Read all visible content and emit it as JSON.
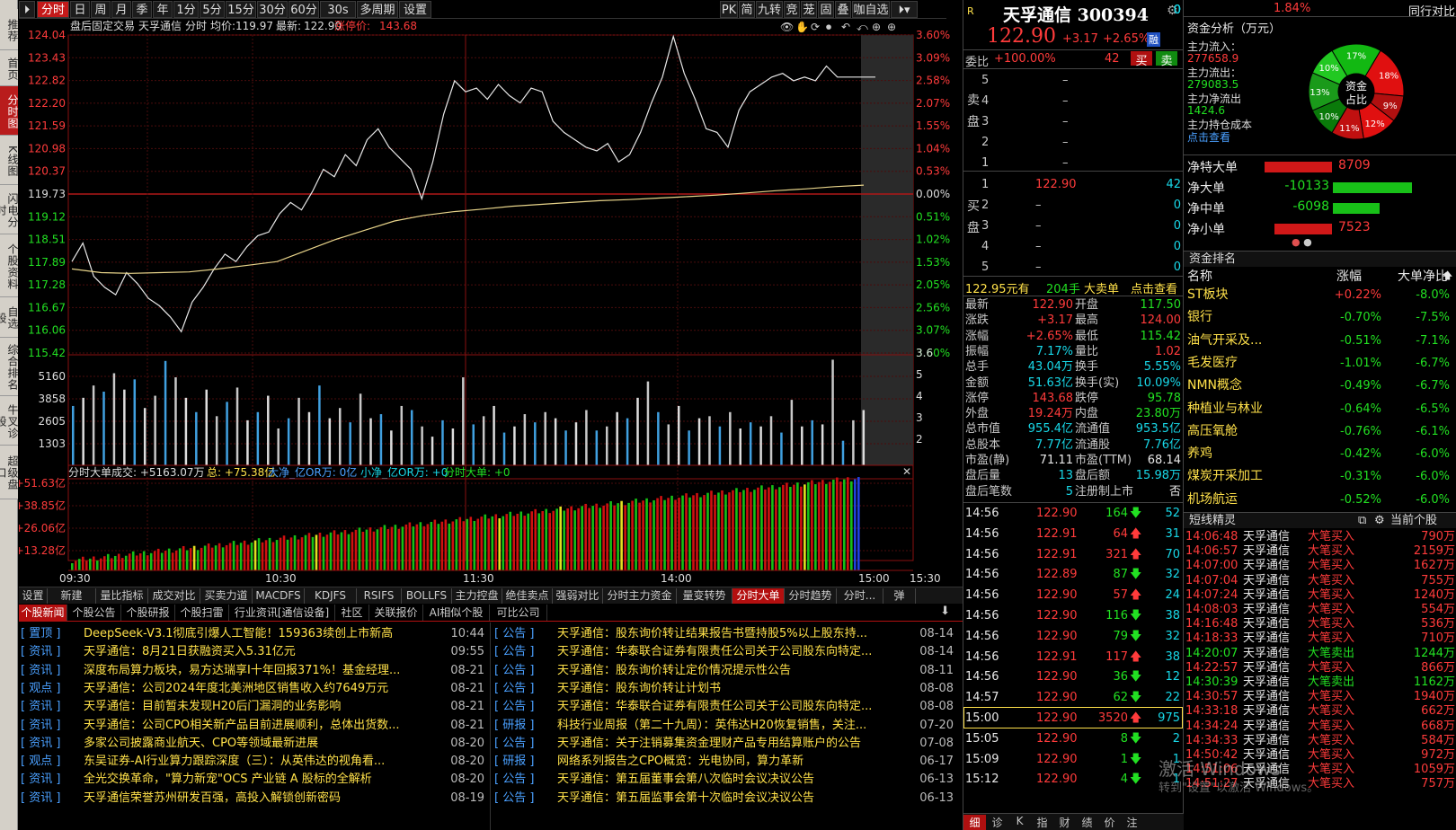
{
  "left_nav": [
    "推荐",
    "首页",
    "分时图",
    "K线图",
    "闪电分时",
    "个股资料",
    "自选股",
    "综合排名",
    "牛叉诊股",
    "超级盘口"
  ],
  "top_tabs": [
    "分时",
    "日",
    "周",
    "月",
    "季",
    "年",
    "1分",
    "5分",
    "15分",
    "30分",
    "60分",
    "30s",
    "多周期",
    "设置"
  ],
  "top_right_tabs": [
    "PK",
    "简",
    "九转",
    "竞",
    "茏",
    "固",
    "叠",
    "咖自选"
  ],
  "chart_header": {
    "title": "盘后固定交易",
    "stock": "天孚通信",
    "mode": "分时",
    "avg_label": "均价:",
    "avg": "119.97",
    "last_label": "最新:",
    "last": "122.90",
    "limit_label": "涨停价:",
    "limit": "143.68"
  },
  "chart_data": {
    "type": "line",
    "price_ticks": [
      "124.04",
      "123.43",
      "122.82",
      "122.20",
      "121.59",
      "120.98",
      "120.37",
      "119.73",
      "119.12",
      "118.51",
      "117.89",
      "117.28",
      "116.67",
      "116.06",
      "115.42"
    ],
    "pct_ticks": [
      "3.60%",
      "3.09%",
      "2.58%",
      "2.07%",
      "1.55%",
      "1.04%",
      "0.53%",
      "0.00%",
      "0.51%",
      "1.02%",
      "1.53%",
      "2.05%",
      "2.56%",
      "3.07%",
      "3.60%"
    ],
    "ylim": [
      115.42,
      124.04
    ],
    "prev_close": 119.73,
    "price": [
      117.9,
      118.4,
      117.5,
      117.2,
      117.0,
      117.6,
      117.3,
      116.9,
      116.7,
      116.4,
      116.0,
      116.8,
      117.2,
      117.7,
      118.1,
      117.9,
      118.3,
      118.6,
      118.7,
      119.2,
      119.5,
      119.3,
      119.8,
      120.4,
      120.2,
      120.8,
      120.5,
      121.2,
      121.5,
      121.0,
      120.7,
      120.4,
      119.6,
      120.6,
      121.9,
      122.8,
      122.5,
      122.6,
      122.3,
      122.7,
      122.4,
      122.2,
      122.6,
      122.5,
      121.7,
      121.4,
      121.2,
      121.0,
      120.9,
      121.1,
      120.6,
      120.8,
      121.4,
      122.2,
      122.9,
      124.0,
      123.0,
      122.3,
      121.5,
      121.4,
      121.0,
      122.0,
      122.5,
      122.7,
      122.9,
      123.0,
      122.8,
      122.9,
      122.8,
      123.2,
      122.9,
      122.9,
      122.9
    ],
    "avg": [
      117.7,
      117.6,
      117.58,
      117.6,
      117.62,
      117.7,
      117.8,
      117.9,
      118.2,
      118.5,
      118.75,
      119.0,
      119.15,
      119.25,
      119.32,
      119.4,
      119.45,
      119.5,
      119.55,
      119.58,
      119.62,
      119.66,
      119.7,
      119.76,
      119.82,
      119.87,
      119.93,
      119.97
    ],
    "volume_ticks": [
      "5160",
      "3858",
      "2605",
      "1303"
    ],
    "volume_right_ticks": [
      "3.6",
      "5",
      "4",
      "3",
      "2"
    ],
    "volume": [
      2900,
      3300,
      3900,
      3600,
      4500,
      3700,
      4200,
      2800,
      3400,
      5100,
      4300,
      3300,
      2600,
      3700,
      2400,
      3100,
      3800,
      2200,
      2600,
      3400,
      1800,
      2300,
      3300,
      2600,
      3900,
      2300,
      2800,
      2100,
      3500,
      2300,
      2500,
      1700,
      2900,
      2700,
      1900,
      1400,
      2200,
      1800,
      4300,
      2000,
      2400,
      2900,
      1600,
      1900,
      2500,
      2100,
      2600,
      2300,
      1700,
      2100,
      2700,
      1700,
      1900,
      2600,
      2300,
      3300,
      4100,
      2600,
      2000,
      2900,
      1700,
      2300,
      2400,
      1900,
      2600,
      1800,
      2100,
      1900,
      2400,
      1600,
      3200,
      1900,
      2200,
      2000,
      5160,
      1200,
      2200,
      2700
    ],
    "flow_ticks": [
      "+51.63亿",
      "+38.85亿",
      "+26.06亿",
      "+13.28亿"
    ],
    "time_ticks": [
      "09:30",
      "10:30",
      "11:30",
      "14:00",
      "15:00",
      "15:30"
    ]
  },
  "flow_header": {
    "name": "分时大单",
    "turnover": "成交: +5163.07万",
    "total": "总: +75.38亿",
    "big": "大净_亿OR万: 0亿",
    "small": "小净_亿OR万: +0",
    "big2": "分时大单: +0"
  },
  "bottom_tabs": [
    "设置",
    "新建",
    "量比指标",
    "成交对比",
    "买卖力道",
    "MACDFS",
    "KDJFS",
    "RSIFS",
    "BOLLFS",
    "主力控盘",
    "绝佳卖点",
    "强弱对比",
    "分时主力资金",
    "量变转势",
    "分时大单",
    "分时趋势",
    "分时...",
    "弹"
  ],
  "news_tabs": [
    "个股新闻",
    "个股公告",
    "个股研报",
    "个股扫雷",
    "行业资讯[通信设备]",
    "社区",
    "关联报价",
    "AI相似个股",
    "可比公司"
  ],
  "news_left": [
    {
      "tag": "[ 置顶 ]",
      "title": "DeepSeek-V3.1彻底引爆人工智能！159363续创上市新高",
      "date": "10:44"
    },
    {
      "tag": "[ 资讯 ]",
      "title": "天孚通信：8月21日获融资买入5.31亿元",
      "date": "09:55"
    },
    {
      "tag": "[ 资讯 ]",
      "title": "深度布局算力板块，易方达瑞享I十年回报371%！基金经理...",
      "date": "08-21"
    },
    {
      "tag": "[ 观点 ]",
      "title": "天孚通信：公司2024年度北美洲地区销售收入约7649万元",
      "date": "08-21"
    },
    {
      "tag": "[ 资讯 ]",
      "title": "天孚通信：目前暂未发现H20后门漏洞的业务影响",
      "date": "08-21"
    },
    {
      "tag": "[ 资讯 ]",
      "title": "天孚通信：公司CPO相关新产品目前进展顺利，总体出货数...",
      "date": "08-21"
    },
    {
      "tag": "[ 资讯 ]",
      "title": "多家公司披露商业航天、CPO等领域最新进展",
      "date": "08-20"
    },
    {
      "tag": "[ 观点 ]",
      "title": "东吴证券-AI行业算力跟踪深度（三）：从英伟达的视角看...",
      "date": "08-20"
    },
    {
      "tag": "[ 资讯 ]",
      "title": "全光交换革命，\"算力新宠\"OCS 产业链 A 股标的全解析",
      "date": "08-20"
    },
    {
      "tag": "[ 资讯 ]",
      "title": "天孚通信荣誉苏州研发百强，高投入解锁创新密码",
      "date": "08-19"
    }
  ],
  "news_right": [
    {
      "tag": "[ 公告 ]",
      "title": "天孚通信：股东询价转让结果报告书暨持股5%以上股东持...",
      "date": "08-14"
    },
    {
      "tag": "[ 公告 ]",
      "title": "天孚通信：华泰联合证券有限责任公司关于公司股东向特定...",
      "date": "08-14"
    },
    {
      "tag": "[ 公告 ]",
      "title": "天孚通信：股东询价转让定价情况提示性公告",
      "date": "08-11"
    },
    {
      "tag": "[ 公告 ]",
      "title": "天孚通信：股东询价转让计划书",
      "date": "08-08"
    },
    {
      "tag": "[ 公告 ]",
      "title": "天孚通信：华泰联合证券有限责任公司关于公司股东向特定...",
      "date": "08-08"
    },
    {
      "tag": "[ 研报 ]",
      "title": "科技行业周报（第二十九周）：英伟达H20恢复销售，关注...",
      "date": "07-20"
    },
    {
      "tag": "[ 公告 ]",
      "title": "天孚通信：关于注销募集资金理财产品专用结算账户的公告",
      "date": "07-08"
    },
    {
      "tag": "[ 研报 ]",
      "title": "网络系列报告之CPO概览：光电协同，算力革新",
      "date": "06-17"
    },
    {
      "tag": "[ 公告 ]",
      "title": "天孚通信：第五届董事会第八次临时会议决议公告",
      "date": "06-13"
    },
    {
      "tag": "[ 公告 ]",
      "title": "天孚通信：第五届监事会第十次临时会议决议公告",
      "date": "06-13"
    }
  ],
  "quote": {
    "badge": "R",
    "name": "天孚通信 300394",
    "price": "122.90",
    "change": "+3.17",
    "pct": "+2.65%",
    "rong": "融",
    "weibi_label": "委比",
    "weibi": "+100.00%",
    "weicha": "42",
    "buy_btn": "买",
    "sell_btn": "卖",
    "sell_label": "卖盘",
    "buy_label": "买盘",
    "asks": [
      {
        "lvl": "5",
        "p": "–",
        "v": "0"
      },
      {
        "lvl": "4",
        "p": "–",
        "v": "0"
      },
      {
        "lvl": "3",
        "p": "–",
        "v": "0"
      },
      {
        "lvl": "2",
        "p": "–",
        "v": "0"
      },
      {
        "lvl": "1",
        "p": "–",
        "v": "0"
      }
    ],
    "bids": [
      {
        "lvl": "1",
        "p": "122.90",
        "v": "42"
      },
      {
        "lvl": "2",
        "p": "–",
        "v": "0"
      },
      {
        "lvl": "3",
        "p": "–",
        "v": "0"
      },
      {
        "lvl": "4",
        "p": "–",
        "v": "0"
      },
      {
        "lvl": "5",
        "p": "–",
        "v": "0"
      }
    ],
    "bigsell": {
      "price": "122.95元有",
      "vol": "204手",
      "label": "大卖单",
      "link": "点击查看"
    },
    "stats": [
      [
        "最新",
        "122.90",
        "red",
        "开盘",
        "117.50",
        "green"
      ],
      [
        "涨跌",
        "+3.17",
        "red",
        "最高",
        "124.00",
        "red"
      ],
      [
        "涨幅",
        "+2.65%",
        "red",
        "最低",
        "115.42",
        "green"
      ],
      [
        "振幅",
        "7.17%",
        "cyan",
        "量比",
        "1.02",
        "red"
      ],
      [
        "总手",
        "43.04万",
        "cyan",
        "换手",
        "5.55%",
        "cyan"
      ],
      [
        "金额",
        "51.63亿",
        "cyan",
        "换手(实)",
        "10.09%",
        "cyan"
      ],
      [
        "涨停",
        "143.68",
        "red",
        "跌停",
        "95.78",
        "green"
      ],
      [
        "外盘",
        "19.24万",
        "red",
        "内盘",
        "23.80万",
        "green"
      ],
      [
        "总市值",
        "955.4亿",
        "cyan",
        "流通值",
        "953.5亿",
        "cyan"
      ],
      [
        "总股本",
        "7.77亿",
        "cyan",
        "流通股",
        "7.76亿",
        "cyan"
      ],
      [
        "市盈(静)",
        "71.11",
        "white",
        "市盈(TTM)",
        "68.14",
        "white"
      ],
      [
        "盘后量",
        "13",
        "cyan",
        "盘后额",
        "15.98万",
        "cyan"
      ],
      [
        "盘后笔数",
        "5",
        "cyan",
        "注册制上市",
        "否",
        "white"
      ]
    ],
    "ticks": [
      {
        "t": "14:56",
        "p": "122.90",
        "v": "164",
        "d": "down",
        "n": "52"
      },
      {
        "t": "14:56",
        "p": "122.91",
        "v": "64",
        "d": "up",
        "n": "31"
      },
      {
        "t": "14:56",
        "p": "122.91",
        "v": "321",
        "d": "up",
        "n": "70"
      },
      {
        "t": "14:56",
        "p": "122.89",
        "v": "87",
        "d": "down",
        "n": "32"
      },
      {
        "t": "14:56",
        "p": "122.90",
        "v": "57",
        "d": "up",
        "n": "24"
      },
      {
        "t": "14:56",
        "p": "122.90",
        "v": "116",
        "d": "down",
        "n": "38"
      },
      {
        "t": "14:56",
        "p": "122.90",
        "v": "79",
        "d": "down",
        "n": "32"
      },
      {
        "t": "14:56",
        "p": "122.91",
        "v": "117",
        "d": "up",
        "n": "38"
      },
      {
        "t": "14:56",
        "p": "122.90",
        "v": "36",
        "d": "down",
        "n": "12"
      },
      {
        "t": "14:57",
        "p": "122.90",
        "v": "62",
        "d": "down",
        "n": "22"
      },
      {
        "t": "15:00",
        "p": "122.90",
        "v": "3520",
        "d": "up",
        "n": "975"
      },
      {
        "t": "15:05",
        "p": "122.90",
        "v": "8",
        "d": "down",
        "n": "2"
      },
      {
        "t": "15:09",
        "p": "122.90",
        "v": "1",
        "d": "down",
        "n": "1"
      },
      {
        "t": "15:12",
        "p": "122.90",
        "v": "4",
        "d": "down",
        "n": "1"
      }
    ],
    "bottom_tabs": [
      "细",
      "诊",
      "K",
      "指",
      "财",
      "绩",
      "价",
      "注"
    ]
  },
  "flow": {
    "top_pct": "1.84%",
    "top_right": "同行对比",
    "title": "资金分析（万元）",
    "in_label": "主力流入：",
    "in": "277658.9",
    "out_label": "主力流出：",
    "out": "279083.5",
    "net_label": "主力净流出",
    "net": "1424.6",
    "cost_label": "主力持仓成本",
    "cost_link": "点击查看",
    "pie_center": "资金\n占比",
    "pie": [
      {
        "l": "17%",
        "c": "#12b812"
      },
      {
        "l": "18%",
        "c": "#e01010"
      },
      {
        "l": "9%",
        "c": "#b01010"
      },
      {
        "l": "12%",
        "c": "#e01010"
      },
      {
        "l": "11%",
        "c": "#c01010"
      },
      {
        "l": "10%",
        "c": "#0a7a0a"
      },
      {
        "l": "13%",
        "c": "#1a9a1a"
      },
      {
        "l": "10%",
        "c": "#22c822"
      }
    ],
    "net_rows": [
      {
        "l": "净特大单",
        "v": "8709",
        "c": "#d01818",
        "side": "left",
        "w": 75
      },
      {
        "l": "净大单",
        "v": "-10133",
        "c": "#18c018",
        "side": "right",
        "w": 88
      },
      {
        "l": "净中单",
        "v": "-6098",
        "c": "#18c018",
        "side": "right",
        "w": 52
      },
      {
        "l": "净小单",
        "v": "7523",
        "c": "#d01818",
        "side": "left",
        "w": 64
      }
    ],
    "rank_title": "资金排名",
    "rank_head": [
      "名称",
      "涨幅",
      "大单净比"
    ],
    "rank": [
      [
        "ST板块",
        "+0.22%",
        "-8.0%"
      ],
      [
        "银行",
        "-0.70%",
        "-7.5%"
      ],
      [
        "油气开采及...",
        "-0.51%",
        "-7.1%"
      ],
      [
        "毛发医疗",
        "-1.01%",
        "-6.7%"
      ],
      [
        "NMN概念",
        "-0.49%",
        "-6.7%"
      ],
      [
        "种植业与林业",
        "-0.64%",
        "-6.5%"
      ],
      [
        "高压氧舱",
        "-0.76%",
        "-6.1%"
      ],
      [
        "养鸡",
        "-0.42%",
        "-6.0%"
      ],
      [
        "煤炭开采加工",
        "-0.31%",
        "-6.0%"
      ],
      [
        "机场航运",
        "-0.52%",
        "-6.0%"
      ]
    ],
    "elf_title": "短线精灵",
    "elf_right": "当前个股",
    "elf": [
      [
        "14:06:48",
        "天孚通信",
        "大笔买入",
        "790万",
        "r"
      ],
      [
        "14:06:57",
        "天孚通信",
        "大笔买入",
        "2159万",
        "r"
      ],
      [
        "14:07:00",
        "天孚通信",
        "大笔买入",
        "1627万",
        "r"
      ],
      [
        "14:07:04",
        "天孚通信",
        "大笔买入",
        "755万",
        "r"
      ],
      [
        "14:07:24",
        "天孚通信",
        "大笔买入",
        "1240万",
        "r"
      ],
      [
        "14:08:03",
        "天孚通信",
        "大笔买入",
        "554万",
        "r"
      ],
      [
        "14:16:48",
        "天孚通信",
        "大笔买入",
        "536万",
        "r"
      ],
      [
        "14:18:33",
        "天孚通信",
        "大笔买入",
        "710万",
        "r"
      ],
      [
        "14:20:07",
        "天孚通信",
        "大笔卖出",
        "1244万",
        "g"
      ],
      [
        "14:22:57",
        "天孚通信",
        "大笔买入",
        "866万",
        "r"
      ],
      [
        "14:30:39",
        "天孚通信",
        "大笔卖出",
        "1162万",
        "g"
      ],
      [
        "14:30:57",
        "天孚通信",
        "大笔买入",
        "1940万",
        "r"
      ],
      [
        "14:33:18",
        "天孚通信",
        "大笔买入",
        "662万",
        "r"
      ],
      [
        "14:34:24",
        "天孚通信",
        "大笔买入",
        "668万",
        "r"
      ],
      [
        "14:34:33",
        "天孚通信",
        "大笔买入",
        "584万",
        "r"
      ],
      [
        "14:50:42",
        "天孚通信",
        "大笔买入",
        "972万",
        "r"
      ],
      [
        "14:51:06",
        "天孚通信",
        "大笔买入",
        "1059万",
        "r"
      ],
      [
        "14:51:27",
        "天孚通信",
        "大笔买入",
        "757万",
        "r"
      ]
    ],
    "watermark1": "激活 Windows",
    "watermark2": "转到\"设置\"以激活 Windows。"
  }
}
